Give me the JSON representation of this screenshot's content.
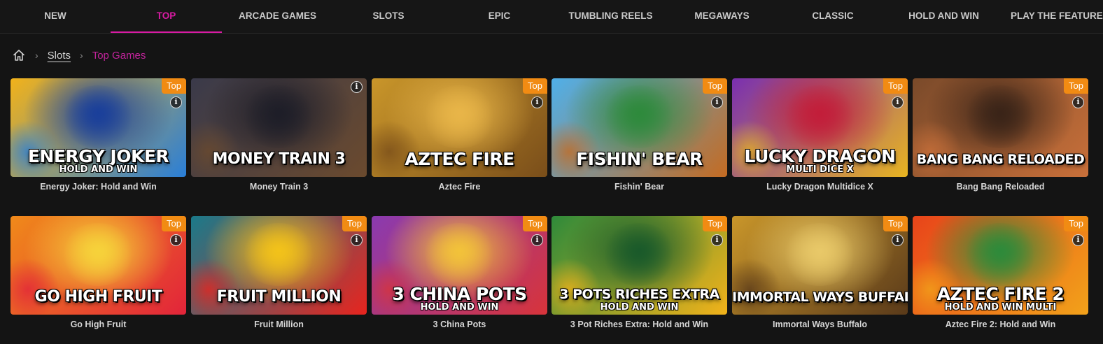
{
  "nav": {
    "tabs": [
      {
        "label": "NEW",
        "active": false
      },
      {
        "label": "TOP",
        "active": true
      },
      {
        "label": "ARCADE GAMES",
        "active": false
      },
      {
        "label": "SLOTS",
        "active": false
      },
      {
        "label": "EPIC",
        "active": false
      },
      {
        "label": "TUMBLING REELS",
        "active": false
      },
      {
        "label": "MEGAWAYS",
        "active": false
      },
      {
        "label": "CLASSIC",
        "active": false
      },
      {
        "label": "HOLD AND WIN",
        "active": false
      },
      {
        "label": "PLAY THE FEATURE",
        "active": false
      }
    ],
    "accent_color": "#d81ba3"
  },
  "breadcrumb": {
    "home_icon": "home-icon",
    "items": [
      {
        "label": "Slots"
      },
      {
        "label": "Top Games"
      }
    ]
  },
  "badge_color": "#f18b13",
  "games": [
    {
      "name": "Energy Joker: Hold and Win",
      "art_title": "ENERGY JOKER",
      "art_subtitle": "HOLD AND WIN",
      "badge": "Top",
      "colors": [
        "#f2b21a",
        "#2a7fd8",
        "#1a3f9a"
      ]
    },
    {
      "name": "Money Train 3",
      "art_title": "MONEY TRAIN 3",
      "art_subtitle": "",
      "badge": "",
      "colors": [
        "#3a3a4a",
        "#6b4a2e",
        "#1e1e28"
      ]
    },
    {
      "name": "Aztec Fire",
      "art_title": "AZTEC FIRE",
      "art_subtitle": "",
      "badge": "Top",
      "colors": [
        "#c9962a",
        "#7a4e1a",
        "#e8b548"
      ]
    },
    {
      "name": "Fishin' Bear",
      "art_title": "FISHIN' BEAR",
      "art_subtitle": "",
      "badge": "Top",
      "colors": [
        "#4fb0ea",
        "#c46b22",
        "#2e8a3c"
      ]
    },
    {
      "name": "Lucky Dragon Multidice X",
      "art_title": "LUCKY DRAGON",
      "art_subtitle": "MULTI DICE X",
      "badge": "Top",
      "colors": [
        "#7a2fb0",
        "#e8b420",
        "#c21e3a"
      ]
    },
    {
      "name": "Bang Bang Reloaded",
      "art_title": "BANG BANG RELOADED",
      "art_subtitle": "",
      "badge": "Top",
      "colors": [
        "#7a4a2a",
        "#c9703a",
        "#3a2418"
      ]
    },
    {
      "name": "Go High Fruit",
      "art_title": "GO HIGH FRUIT",
      "art_subtitle": "",
      "badge": "Top",
      "colors": [
        "#f08a1a",
        "#e2243a",
        "#f6d23a"
      ]
    },
    {
      "name": "Fruit Million",
      "art_title": "FRUIT MILLION",
      "art_subtitle": "",
      "badge": "Top",
      "colors": [
        "#1a7a8a",
        "#e8241e",
        "#f2c21a"
      ]
    },
    {
      "name": "3 China Pots",
      "art_title": "3 CHINA POTS",
      "art_subtitle": "HOLD AND WIN",
      "badge": "Top",
      "colors": [
        "#8a3ab0",
        "#d8343a",
        "#f2c23a"
      ]
    },
    {
      "name": "3 Pot Riches Extra: Hold and Win",
      "art_title": "3 POTS RICHES EXTRA",
      "art_subtitle": "HOLD AND WIN",
      "badge": "Top",
      "colors": [
        "#2e8a3a",
        "#f2b21a",
        "#1a5a2a"
      ]
    },
    {
      "name": "Immortal Ways Buffalo",
      "art_title": "IMMORTAL WAYS BUFFALO",
      "art_subtitle": "",
      "badge": "Top",
      "colors": [
        "#c9962a",
        "#5a3a1a",
        "#e8c868"
      ]
    },
    {
      "name": "Aztec Fire 2: Hold and Win",
      "art_title": "AZTEC FIRE 2",
      "art_subtitle": "HOLD AND WIN MULTI",
      "badge": "Top",
      "colors": [
        "#e8441a",
        "#f2a21a",
        "#2e8a3a"
      ]
    }
  ]
}
